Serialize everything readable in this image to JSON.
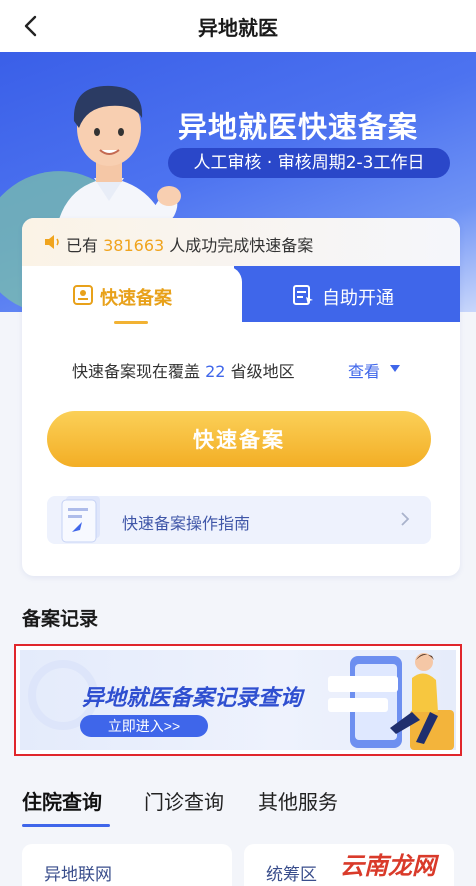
{
  "header": {
    "title": "异地就医"
  },
  "hero": {
    "title": "异地就医快速备案",
    "subtitle": "人工审核 · 审核周期2-3工作日"
  },
  "notice": {
    "prefix": "已有",
    "count": "381663",
    "suffix": "人成功完成快速备案"
  },
  "tabs": [
    {
      "label": "快速备案",
      "icon": "id-card-icon"
    },
    {
      "label": "自助开通",
      "icon": "document-pointer-icon"
    }
  ],
  "coverage": {
    "prefix": "快速备案现在覆盖",
    "count": "22",
    "suffix": "省级地区",
    "link": "查看"
  },
  "primary_button": "快速备案",
  "guide": {
    "label": "快速备案操作指南"
  },
  "records": {
    "section_title": "备案记录",
    "banner_title": "异地就医备案记录查询",
    "banner_button": "立即进入>>"
  },
  "bottom_tabs": [
    "住院查询",
    "门诊查询",
    "其他服务"
  ],
  "bottom_cards": [
    "异地联网",
    "统筹区"
  ],
  "watermark": "云南龙网",
  "colors": {
    "primary_blue": "#3f66ea",
    "accent_orange": "#f3ae25",
    "highlight_red": "#e0262b"
  }
}
